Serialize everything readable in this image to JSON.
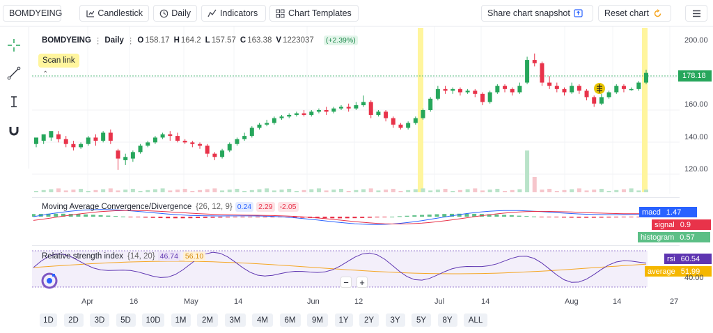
{
  "toolbar": {
    "symbol": "BOMDYEING",
    "chart_type": "Candlestick",
    "interval": "Daily",
    "indicators": "Indicators",
    "templates": "Chart Templates",
    "snapshot": "Share chart snapshot",
    "reset": "Reset chart"
  },
  "legend": {
    "symbol": "BOMDYEING",
    "interval": "Daily",
    "o_label": "O",
    "o": "158.17",
    "h_label": "H",
    "h": "164.2",
    "l_label": "L",
    "l": "157.57",
    "c_label": "C",
    "c": "163.38",
    "v_label": "V",
    "v": "1223037",
    "change": "(+2.39%)",
    "scan_link": "Scan link"
  },
  "price_axis": {
    "ticks": [
      "200.00",
      "160.00",
      "140.00",
      "120.00"
    ],
    "current": "178.18"
  },
  "macd": {
    "title": "Moving Average Convergence/Divergence",
    "params": "{26, 12, 9}",
    "v1": "0.24",
    "v2": "2.29",
    "v3": "-2.05",
    "labels": {
      "macd": "macd",
      "macd_val": "1.47",
      "signal": "signal",
      "signal_val": "0.9",
      "histogram": "histogram",
      "histogram_val": "0.57"
    }
  },
  "rsi": {
    "title": "Relative strength index",
    "params": "{14, 20}",
    "v1": "46.74",
    "v2": "56.10",
    "labels": {
      "rsi": "rsi",
      "rsi_val": "60.54",
      "average": "average",
      "average_val": "51.99"
    },
    "axis": "40.00"
  },
  "zoom": {
    "minus": "−",
    "plus": "+"
  },
  "time_axis": [
    "Apr",
    "16",
    "May",
    "14",
    "Jun",
    "12",
    "Jul",
    "14",
    "Aug",
    "14",
    "27"
  ],
  "timeframes": [
    "1D",
    "2D",
    "3D",
    "5D",
    "10D",
    "1M",
    "2M",
    "3M",
    "4M",
    "6M",
    "9M",
    "1Y",
    "2Y",
    "3Y",
    "5Y",
    "8Y",
    "ALL"
  ],
  "colors": {
    "up": "#26a65b",
    "down": "#e8334a",
    "accent": "#2962ff",
    "highlight": "#fff59d"
  },
  "chart_data": {
    "type": "candlestick",
    "ylim": [
      105,
      205
    ],
    "candles": [
      [
        134,
        138,
        132,
        136
      ],
      [
        136,
        140,
        134,
        138
      ],
      [
        138,
        142,
        136,
        140
      ],
      [
        140,
        137,
        135,
        142
      ],
      [
        137,
        134,
        132,
        139
      ],
      [
        134,
        132,
        130,
        136
      ],
      [
        132,
        134,
        131,
        135
      ],
      [
        134,
        138,
        133,
        139
      ],
      [
        138,
        136,
        133,
        140
      ],
      [
        136,
        141,
        135,
        142
      ],
      [
        141,
        136,
        134,
        143
      ],
      [
        130,
        125,
        118,
        131
      ],
      [
        124,
        126,
        121,
        128
      ],
      [
        125,
        129,
        123,
        130
      ],
      [
        129,
        133,
        128,
        134
      ],
      [
        133,
        135,
        132,
        136
      ],
      [
        135,
        138,
        134,
        139
      ],
      [
        138,
        140,
        137,
        141
      ],
      [
        140,
        139,
        136,
        142
      ],
      [
        139,
        136,
        135,
        141
      ],
      [
        136,
        135,
        134,
        137
      ],
      [
        135,
        134,
        132,
        136
      ],
      [
        134,
        133,
        131,
        135
      ],
      [
        133,
        128,
        126,
        134
      ],
      [
        128,
        126,
        124,
        129
      ],
      [
        126,
        130,
        125,
        131
      ],
      [
        130,
        134,
        129,
        135
      ],
      [
        134,
        137,
        133,
        138
      ],
      [
        137,
        139,
        136,
        141
      ],
      [
        139,
        144,
        138,
        145
      ],
      [
        144,
        146,
        143,
        147
      ],
      [
        146,
        147,
        145,
        149
      ],
      [
        147,
        150,
        146,
        151
      ],
      [
        150,
        151,
        149,
        152
      ],
      [
        151,
        152,
        150,
        153
      ],
      [
        152,
        153,
        151,
        154
      ],
      [
        153,
        152,
        151,
        155
      ],
      [
        152,
        154,
        151,
        155
      ],
      [
        154,
        155,
        153,
        156
      ],
      [
        155,
        154,
        152,
        157
      ],
      [
        154,
        156,
        153,
        157
      ],
      [
        156,
        157,
        155,
        158
      ],
      [
        157,
        156,
        154,
        159
      ],
      [
        156,
        158,
        155,
        160
      ],
      [
        158,
        160,
        157,
        164
      ],
      [
        160,
        152,
        150,
        161
      ],
      [
        152,
        154,
        151,
        155
      ],
      [
        154,
        150,
        148,
        155
      ],
      [
        150,
        146,
        144,
        151
      ],
      [
        146,
        144,
        143,
        147
      ],
      [
        144,
        147,
        143,
        148
      ],
      [
        147,
        150,
        146,
        151
      ],
      [
        150,
        155,
        149,
        156
      ],
      [
        155,
        162,
        154,
        163
      ],
      [
        162,
        168,
        161,
        170
      ],
      [
        168,
        167,
        165,
        170
      ],
      [
        167,
        168,
        165,
        169
      ],
      [
        168,
        166,
        164,
        169
      ],
      [
        166,
        167,
        165,
        168
      ],
      [
        167,
        165,
        163,
        168
      ],
      [
        165,
        160,
        158,
        166
      ],
      [
        160,
        166,
        159,
        167
      ],
      [
        166,
        170,
        165,
        171
      ],
      [
        170,
        168,
        166,
        171
      ],
      [
        168,
        166,
        164,
        169
      ],
      [
        166,
        170,
        165,
        172
      ],
      [
        172,
        186,
        171,
        188
      ],
      [
        186,
        184,
        182,
        190
      ],
      [
        184,
        172,
        170,
        185
      ],
      [
        172,
        170,
        168,
        176
      ],
      [
        170,
        168,
        166,
        172
      ],
      [
        168,
        166,
        164,
        169
      ],
      [
        166,
        170,
        165,
        172
      ],
      [
        170,
        167,
        165,
        171
      ],
      [
        167,
        163,
        161,
        168
      ],
      [
        163,
        159,
        157,
        164
      ],
      [
        159,
        163,
        158,
        165
      ],
      [
        163,
        166,
        162,
        167
      ],
      [
        166,
        170,
        165,
        171
      ],
      [
        170,
        168,
        166,
        171
      ],
      [
        168,
        168,
        167,
        169
      ],
      [
        168,
        172,
        167,
        173
      ],
      [
        172,
        178,
        171,
        180
      ]
    ],
    "volume_spikes": [
      {
        "index": 66,
        "note": "large volume bar"
      }
    ]
  }
}
